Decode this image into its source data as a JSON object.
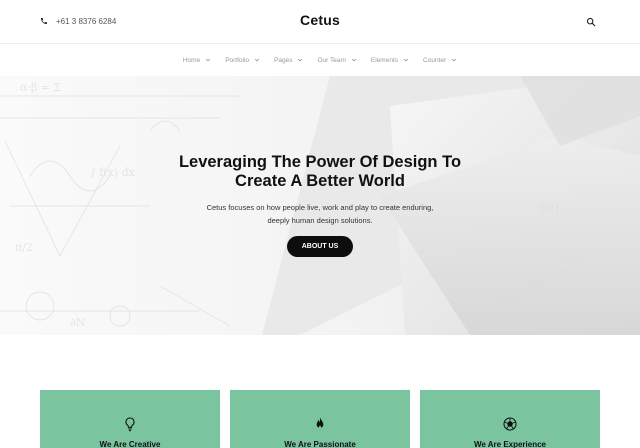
{
  "header": {
    "phone": "+61 3 8376 6284",
    "brand": "Cetus",
    "phone_icon": "phone-icon",
    "search_icon": "search-icon"
  },
  "nav": {
    "items": [
      {
        "label": "Home"
      },
      {
        "label": "Portfolio"
      },
      {
        "label": "Pages"
      },
      {
        "label": "Our Team"
      },
      {
        "label": "Elements"
      },
      {
        "label": "Counter"
      }
    ]
  },
  "hero": {
    "title_line1": "Leveraging The Power Of Design To",
    "title_line2": "Create A Better World",
    "subtitle_line1": "Cetus focuses on how people live, work and play to create enduring,",
    "subtitle_line2": "deeply human design solutions.",
    "button_label": "ABOUT US"
  },
  "features": {
    "accent": "#7bc4a0",
    "cards": [
      {
        "title": "We Are Creative",
        "icon": "lightbulb-icon"
      },
      {
        "title": "We Are Passionate",
        "icon": "flame-icon"
      },
      {
        "title": "We Are Experience",
        "icon": "geometric-ball-icon"
      }
    ]
  }
}
